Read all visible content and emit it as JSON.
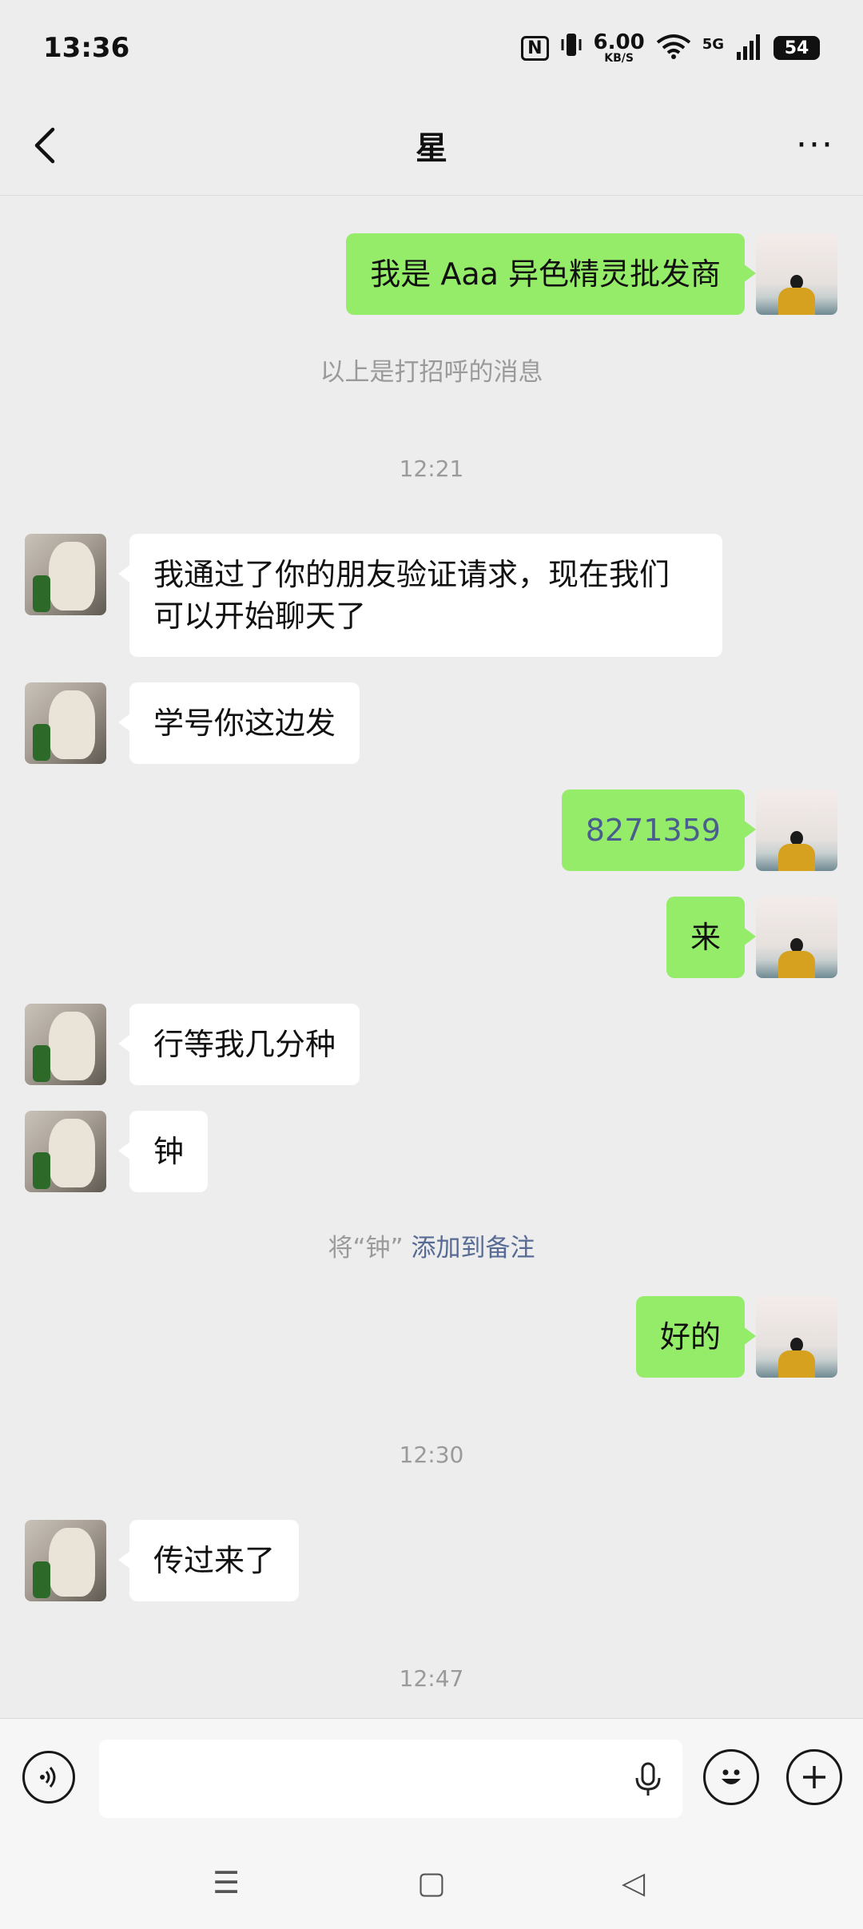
{
  "status_bar": {
    "time": "13:36",
    "nfc_icon": "N",
    "vibrate_icon": "vibrate-icon",
    "speed_value": "6.00",
    "speed_unit": "KB/S",
    "network": "5G",
    "battery": "54"
  },
  "header": {
    "title": "星",
    "back_icon": "chevron-left-icon",
    "more_icon": "···"
  },
  "messages": {
    "m1": "我是 Aaa 异色精灵批发商",
    "greeting_note": "以上是打招呼的消息",
    "time1": "12:21",
    "m2": "我通过了你的朋友验证请求，现在我们可以开始聊天了",
    "m3": "学号你这边发",
    "m4": "8271359",
    "m5": "来",
    "m6": "行等我几分种",
    "m7": "钟",
    "remark_prefix": "将“钟”",
    "remark_link": "添加到备注",
    "m8": "好的",
    "time2": "12:30",
    "m9": "传过来了",
    "time3": "12:47"
  },
  "input_bar": {
    "voice_icon": "voice-icon",
    "mic_icon": "microphone-icon",
    "emoji_icon": "emoji-icon",
    "plus_icon": "plus-icon"
  },
  "nav": {
    "menu": "☰",
    "home": "▢",
    "back": "◁"
  },
  "colors": {
    "bubble_mine": "#95ec69",
    "bubble_theirs": "#ffffff",
    "background": "#ededed",
    "link": "#576b95"
  }
}
